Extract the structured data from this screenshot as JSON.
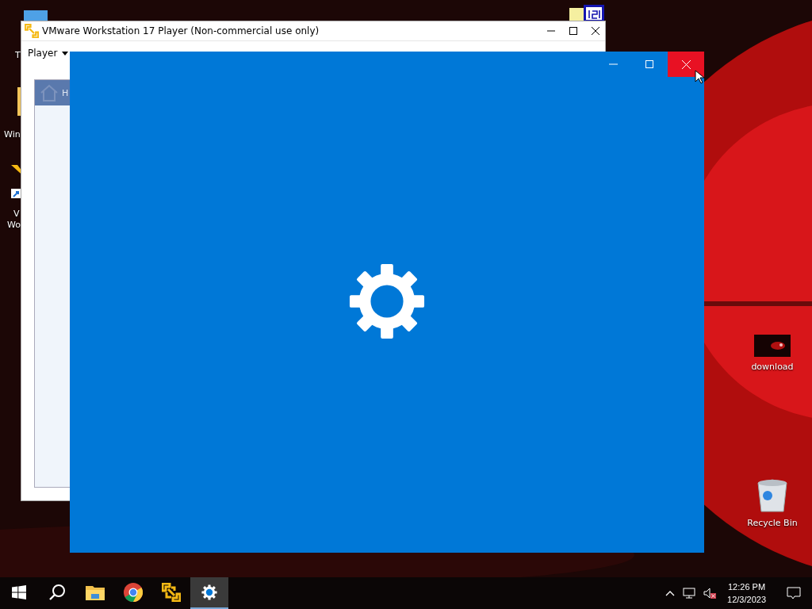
{
  "desktop_icons_left": [
    {
      "kind": "blue",
      "label": "T"
    },
    {
      "kind": "folder",
      "label": "Win"
    },
    {
      "kind": "shortcut",
      "label": "V"
    },
    {
      "label": "Wo"
    }
  ],
  "desktop_icons_right": [
    {
      "kind": "video",
      "label": "download"
    },
    {
      "kind": "recycle",
      "label": "Recycle Bin"
    }
  ],
  "vmware_window": {
    "title": "VMware Workstation 17 Player (Non-commercial use only)",
    "menu": "Player",
    "sidebar_item": "H"
  },
  "settings_window": {
    "close_hovered": true
  },
  "taskbar": {
    "items": [
      {
        "kind": "start",
        "selected": false
      },
      {
        "kind": "search",
        "selected": false
      },
      {
        "kind": "explorer",
        "selected": false
      },
      {
        "kind": "chrome",
        "selected": false
      },
      {
        "kind": "vmware",
        "selected": false
      },
      {
        "kind": "settings",
        "selected": true
      }
    ],
    "time": "12:26 PM",
    "date": "12/3/2023"
  }
}
